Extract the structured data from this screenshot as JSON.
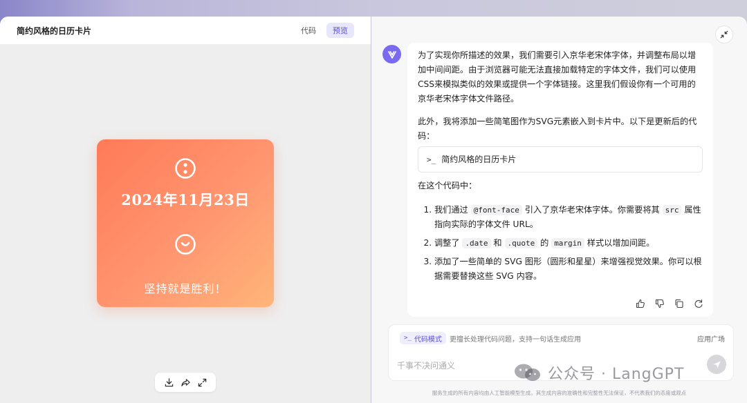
{
  "left": {
    "title": "简约风格的日历卡片",
    "tab_code": "代码",
    "tab_preview": "预览"
  },
  "card": {
    "date": "2024年11月23日",
    "quote": "坚持就是胜利！",
    "gradient_start": "#ff7a57",
    "gradient_end": "#ffb57a"
  },
  "message": {
    "para1": "为了实现你所描述的效果，我们需要引入京华老宋体字体，并调整布局以增加中间间距。由于浏览器可能无法直接加载特定的字体文件，我们可以使用CSS来模拟类似的效果或提供一个字体链接。这里我们假设你有一个可用的京华老宋体字体文件路径。",
    "para2": "此外，我将添加一些简笔图作为SVG元素嵌入到卡片中。以下是更新后的代码：",
    "code_chip_prompt": ">_",
    "code_chip_label": "简约风格的日历卡片",
    "para3": "在这个代码中：",
    "li1_a": "我们通过 ",
    "li1_code1": "@font-face",
    "li1_b": " 引入了京华老宋体字体。你需要将其 ",
    "li1_code2": "src",
    "li1_c": " 属性指向实际的字体文件 URL。",
    "li2_a": "调整了 ",
    "li2_code1": ".date",
    "li2_b": " 和 ",
    "li2_code2": ".quote",
    "li2_c": " 的 ",
    "li2_code3": "margin",
    "li2_d": " 样式以增加间距。",
    "li3": "添加了一些简单的 SVG 图形（圆形和星星）来增强视觉效果。你可以根据需要替换这些 SVG 内容。"
  },
  "composer": {
    "mode_label": "代码模式",
    "mode_desc": "更擅长处理代码问题，支持一句话生成应用",
    "app_plaza": "应用广场",
    "placeholder": "千事不决问通义"
  },
  "disclaimer": "服务生成的所有内容均由人工智能模型生成，其生成内容的准确性和完整性无法保证，不代表我们的态度或观点",
  "watermark": {
    "text": "公众号 · LangGPT"
  },
  "colors": {
    "accent": "#5a4fd8",
    "avatar": "#7a6af1"
  }
}
